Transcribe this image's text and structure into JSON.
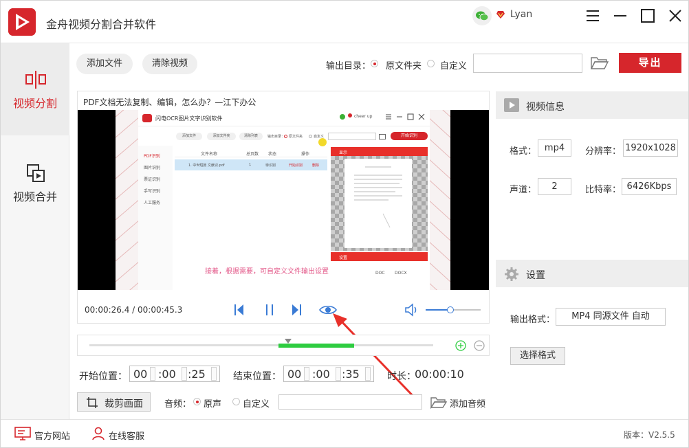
{
  "app": {
    "title": "金舟视频分割合并软件",
    "username": "Lyan",
    "version": "版本：V2.5.5"
  },
  "colors": {
    "brand": "#d6262c",
    "progress": "#2ecc40",
    "accent_blue": "#3a7bd5"
  },
  "sidebar": {
    "items": [
      {
        "label": "视频分割",
        "icon": "split-icon",
        "active": true
      },
      {
        "label": "视频合并",
        "icon": "merge-icon",
        "active": false
      }
    ]
  },
  "toolbar": {
    "add_file": "添加文件",
    "clear_video": "清除视频",
    "output_dir_label": "输出目录：",
    "radio_source": "原文件夹",
    "radio_custom": "自定义",
    "output_path_value": "",
    "export_label": "导出"
  },
  "player": {
    "title": "PDF文档无法复制、编辑，怎么办？—江下办公",
    "time": "00:00:26.4 / 00:00:45.3",
    "volume_level": 0.45
  },
  "embedded_screen": {
    "app_title": "闪电OCR图片文字识别软件",
    "user": "cheer up",
    "btn_add_file": "添加文件",
    "btn_add_folder": "添加文件夹",
    "btn_clear": "清除列表",
    "output_label": "输出目录：",
    "radio_source": "原文件夹",
    "radio_custom": "自定义",
    "start_button": "开始识别",
    "nav": [
      "PDF识别",
      "图片识别",
      "票证识别",
      "手写识别",
      "人工服务"
    ],
    "columns": [
      "文件名称",
      "总页数",
      "状态",
      "操作"
    ],
    "row": {
      "name": "1. 中世短篇 文献识.pdf",
      "pages": "1",
      "status": "待识别",
      "action": "开始识别",
      "delete": "删除"
    },
    "preview_header": "显示",
    "settings_header": "设置",
    "settings_options": [
      "DOC",
      "DOCX"
    ],
    "caption": "接着，根据需要，可自定义文件输出设置"
  },
  "range": {
    "start_label": "开始位置：",
    "start": {
      "h": "00",
      "m": ":00",
      "s": ":25"
    },
    "end_label": "结束位置：",
    "end": {
      "h": "00",
      "m": ":00",
      "s": ":35"
    },
    "duration_label": "时长：",
    "duration": "00:00:10"
  },
  "crop": {
    "label": "裁剪画面"
  },
  "audio": {
    "label": "音频：",
    "original": "原声",
    "custom": "自定义",
    "path_value": "",
    "add_audio": "添加音频"
  },
  "video_info": {
    "header": "视频信息",
    "format_label": "格式：",
    "format": "mp4",
    "resolution_label": "分辨率：",
    "resolution": "1920x1028",
    "channels_label": "声道：",
    "channels": "2",
    "bitrate_label": "比特率：",
    "bitrate": "6426Kbps"
  },
  "settings": {
    "header": "设置",
    "output_format_label": "输出格式：",
    "output_format": "MP4 同源文件 自动",
    "choose_format": "选择格式"
  },
  "footer": {
    "official_site": "官方网站",
    "online_service": "在线客服"
  }
}
